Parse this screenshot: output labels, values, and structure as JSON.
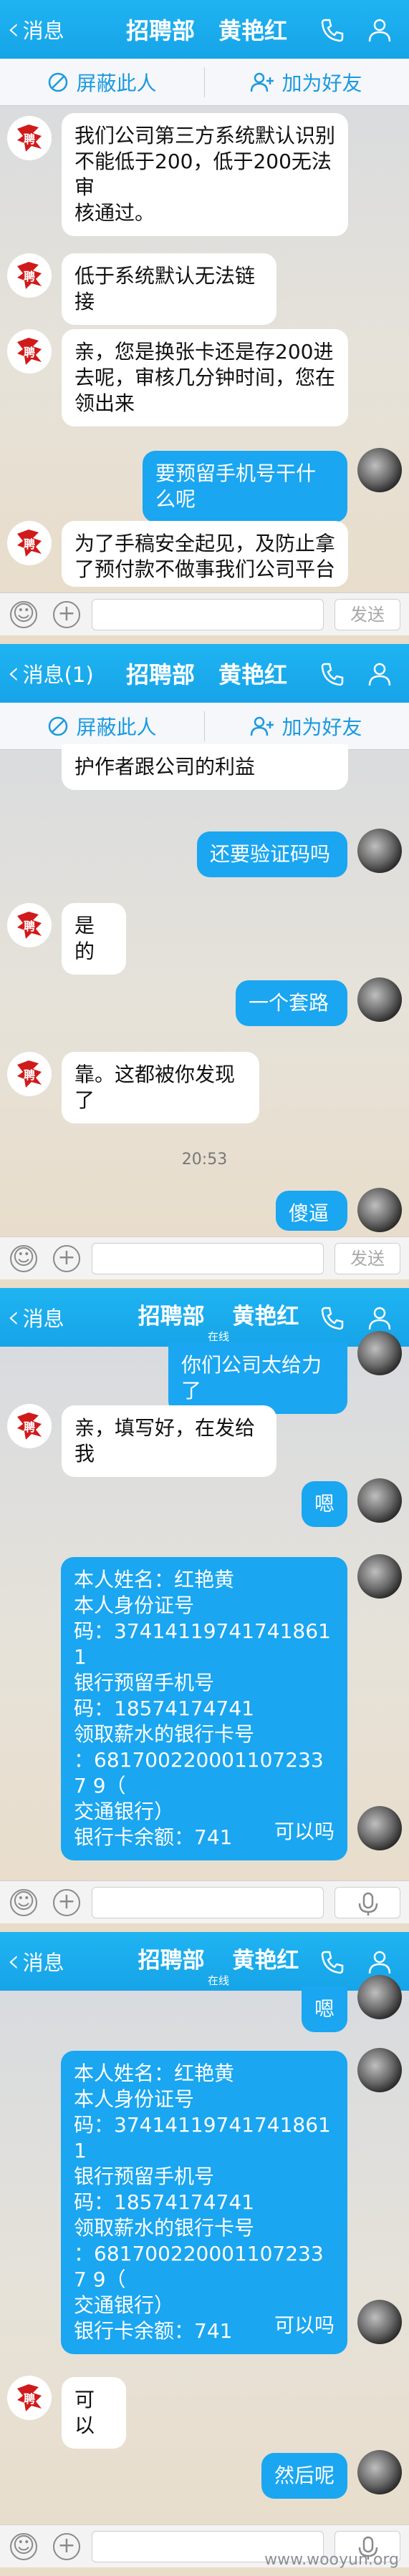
{
  "screens": [
    {
      "back_label": "消息",
      "group": "招聘部",
      "contact": "黄艳红",
      "status": "",
      "block_label": "屏蔽此人",
      "add_label": "加为好友",
      "send_label": "发送",
      "messages": [
        {
          "side": "left",
          "text": "我们公司第三方系统默认识别\n不能低于200，低于200无法审\n核通过。"
        },
        {
          "side": "left",
          "text": "低于系统默认无法链接"
        },
        {
          "side": "left",
          "text": "亲，您是换张卡还是存200进\n去呢，审核几分钟时间，您在\n领出来"
        },
        {
          "side": "right",
          "text": "要预留手机号干什么呢"
        },
        {
          "side": "left",
          "text": "为了手稿安全起见，及防止拿\n了预付款不做事我们公司平台"
        }
      ]
    },
    {
      "back_label": "消息(1)",
      "group": "招聘部",
      "contact": "黄艳红",
      "status": "",
      "block_label": "屏蔽此人",
      "add_label": "加为好友",
      "send_label": "发送",
      "time": "20:53",
      "messages": [
        {
          "side": "left",
          "text": "护作者跟公司的利益"
        },
        {
          "side": "right",
          "text": "还要验证码吗"
        },
        {
          "side": "left",
          "text": "是的"
        },
        {
          "side": "right",
          "text": "一个套路"
        },
        {
          "side": "left",
          "text": "靠。这都被你发现了"
        },
        {
          "side": "right",
          "text": "傻逼"
        }
      ]
    },
    {
      "back_label": "消息",
      "group": "招聘部",
      "contact": "黄艳红",
      "status": "在线",
      "messages": [
        {
          "side": "right",
          "text": "你们公司太给力了"
        },
        {
          "side": "left",
          "text": "亲，填写好，在发给我"
        },
        {
          "side": "right",
          "text": "嗯"
        },
        {
          "side": "right",
          "text": "本人姓名：红艳黄\n本人身份证号\n码：374141197417418611\n银行预留手机号\n码：18574174741\n领取薪水的银行卡号\n：6817002200011072337 9（\n交通银行）\n银行卡余额：741"
        },
        {
          "side": "right",
          "text": "可以吗"
        }
      ]
    },
    {
      "back_label": "消息",
      "group": "招聘部",
      "contact": "黄艳红",
      "status": "在线",
      "messages": [
        {
          "side": "right",
          "text": "嗯"
        },
        {
          "side": "right",
          "text": "本人姓名：红艳黄\n本人身份证号\n码：374141197417418611\n银行预留手机号\n码：18574174741\n领取薪水的银行卡号\n：6817002200011072337 9（\n交通银行）\n银行卡余额：741"
        },
        {
          "side": "right",
          "text": "可以吗"
        },
        {
          "side": "left",
          "text": "可以"
        },
        {
          "side": "right",
          "text": "然后呢"
        }
      ]
    }
  ],
  "watermark": "www.wooyun.org",
  "colors": {
    "header": "#1aa6f0",
    "bubble_right": "#1aa6f0",
    "bubble_left": "#ffffff",
    "link_blue": "#1a9ae0"
  }
}
